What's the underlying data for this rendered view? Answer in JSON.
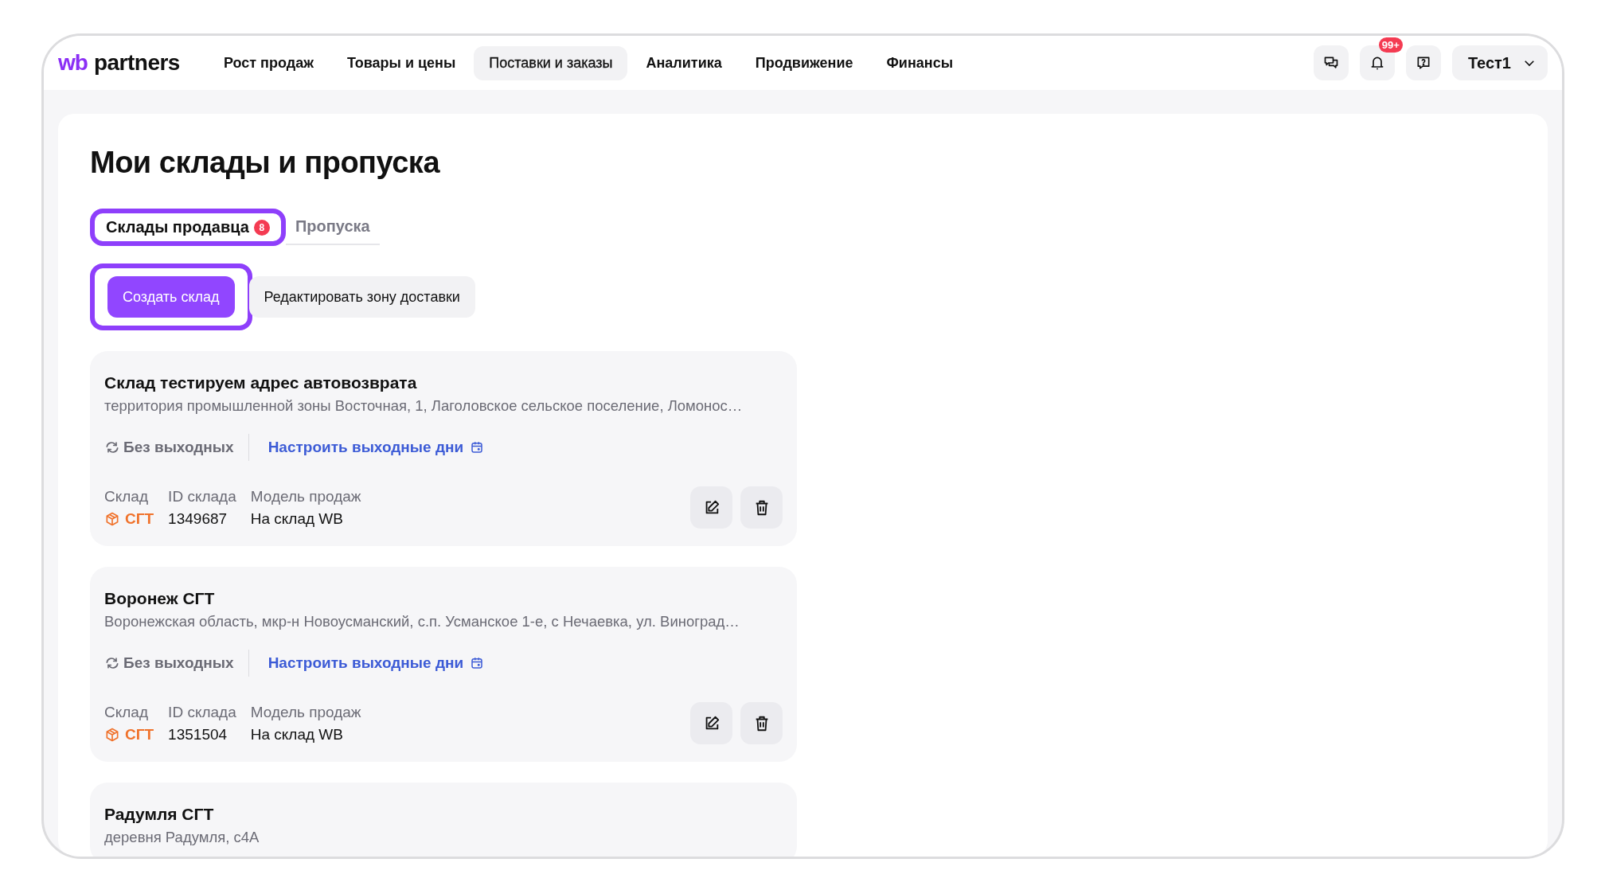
{
  "logo": {
    "mark": "wb",
    "name": "partners"
  },
  "nav": [
    {
      "label": "Рост продаж",
      "selected": false
    },
    {
      "label": "Товары и цены",
      "selected": false
    },
    {
      "label": "Поставки и заказы",
      "selected": true
    },
    {
      "label": "Аналитика",
      "selected": false
    },
    {
      "label": "Продвижение",
      "selected": false
    },
    {
      "label": "Финансы",
      "selected": false
    }
  ],
  "header_icons": [
    {
      "kind": "chat"
    },
    {
      "kind": "bell",
      "badge": "99+"
    },
    {
      "kind": "help"
    }
  ],
  "user": "Тест1",
  "page_title": "Мои склады и пропуска",
  "tabs": [
    {
      "label": "Склады продавца",
      "badge": "8",
      "selected": true,
      "highlighted": true
    },
    {
      "label": "Пропуска",
      "selected": false,
      "highlighted": false
    }
  ],
  "actions": [
    {
      "label": "Создать склад",
      "kind": "primary",
      "highlighted": true
    },
    {
      "label": "Редактировать зону доставки",
      "kind": "secondary",
      "highlighted": false
    }
  ],
  "warehouses": [
    {
      "name": "Склад тестируем адрес автовозврата",
      "address": "территория промышленной зоны Восточная, 1, Лаголовское сельское поселение, Ломонос…",
      "schedule": "Без выходных",
      "schedule_link": "Настроить выходные дни",
      "fields": [
        {
          "label": "Склад",
          "value": "СГТ",
          "kind": "type"
        },
        {
          "label": "ID склада",
          "value": "1349687",
          "kind": "plain"
        },
        {
          "label": "Модель продаж",
          "value": "На склад WB",
          "kind": "plain"
        }
      ]
    },
    {
      "name": "Воронеж СГТ",
      "address": "Воронежская область, мкр-н Новоусманский, с.п. Усманское 1-е, с Нечаевка, ул. Виноград…",
      "schedule": "Без выходных",
      "schedule_link": "Настроить выходные дни",
      "fields": [
        {
          "label": "Склад",
          "value": "СГТ",
          "kind": "type"
        },
        {
          "label": "ID склада",
          "value": "1351504",
          "kind": "plain"
        },
        {
          "label": "Модель продаж",
          "value": "На склад WB",
          "kind": "plain"
        }
      ]
    },
    {
      "name": "Радумля СГТ",
      "address": "деревня Радумля, с4А"
    }
  ]
}
